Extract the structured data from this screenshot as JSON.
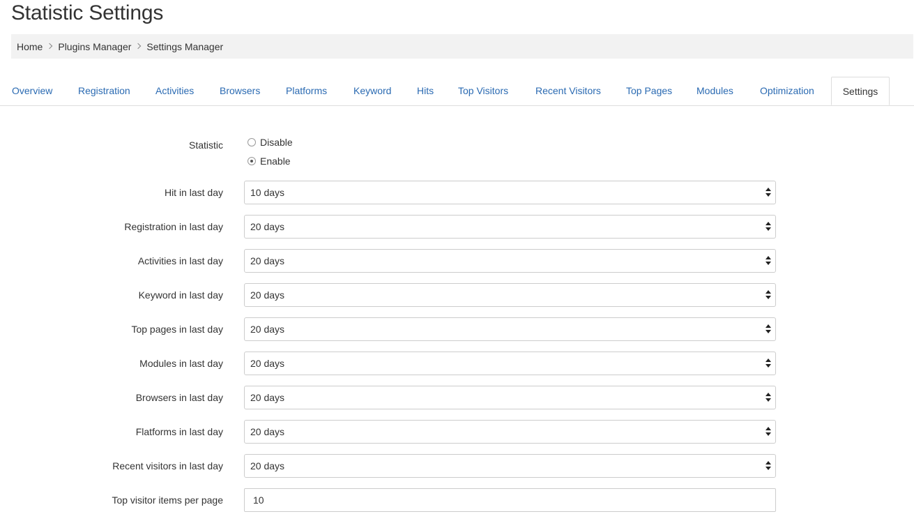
{
  "page": {
    "title": "Statistic Settings"
  },
  "breadcrumb": [
    {
      "label": "Home"
    },
    {
      "label": "Plugins Manager"
    },
    {
      "label": "Settings Manager"
    }
  ],
  "tabs": [
    {
      "label": "Overview"
    },
    {
      "label": "Registration"
    },
    {
      "label": "Activities"
    },
    {
      "label": "Browsers"
    },
    {
      "label": "Platforms"
    },
    {
      "label": "Keyword"
    },
    {
      "label": "Hits"
    },
    {
      "label": "Top Visitors"
    },
    {
      "label": "Recent Visitors"
    },
    {
      "label": "Top Pages"
    },
    {
      "label": "Modules"
    },
    {
      "label": "Optimization"
    },
    {
      "label": "Settings",
      "active": true
    }
  ],
  "form": {
    "statistic": {
      "label": "Statistic",
      "options": [
        {
          "label": "Disable",
          "checked": false
        },
        {
          "label": "Enable",
          "checked": true
        }
      ]
    },
    "selects": [
      {
        "label": "Hit in last day",
        "value": "10 days"
      },
      {
        "label": "Registration in last day",
        "value": "20 days"
      },
      {
        "label": "Activities in last day",
        "value": "20 days"
      },
      {
        "label": "Keyword in last day",
        "value": "20 days"
      },
      {
        "label": "Top pages in last day",
        "value": "20 days"
      },
      {
        "label": "Modules in last day",
        "value": "20 days"
      },
      {
        "label": "Browsers in last day",
        "value": "20 days"
      },
      {
        "label": "Flatforms in last day",
        "value": "20 days"
      },
      {
        "label": "Recent visitors in last day",
        "value": "20 days"
      }
    ],
    "top_visitor_items": {
      "label": "Top visitor items per page",
      "value": "10"
    }
  },
  "colors": {
    "link": "#2a6ab2",
    "breadcrumb_bg": "#f2f2f2",
    "border": "#cccccc"
  }
}
